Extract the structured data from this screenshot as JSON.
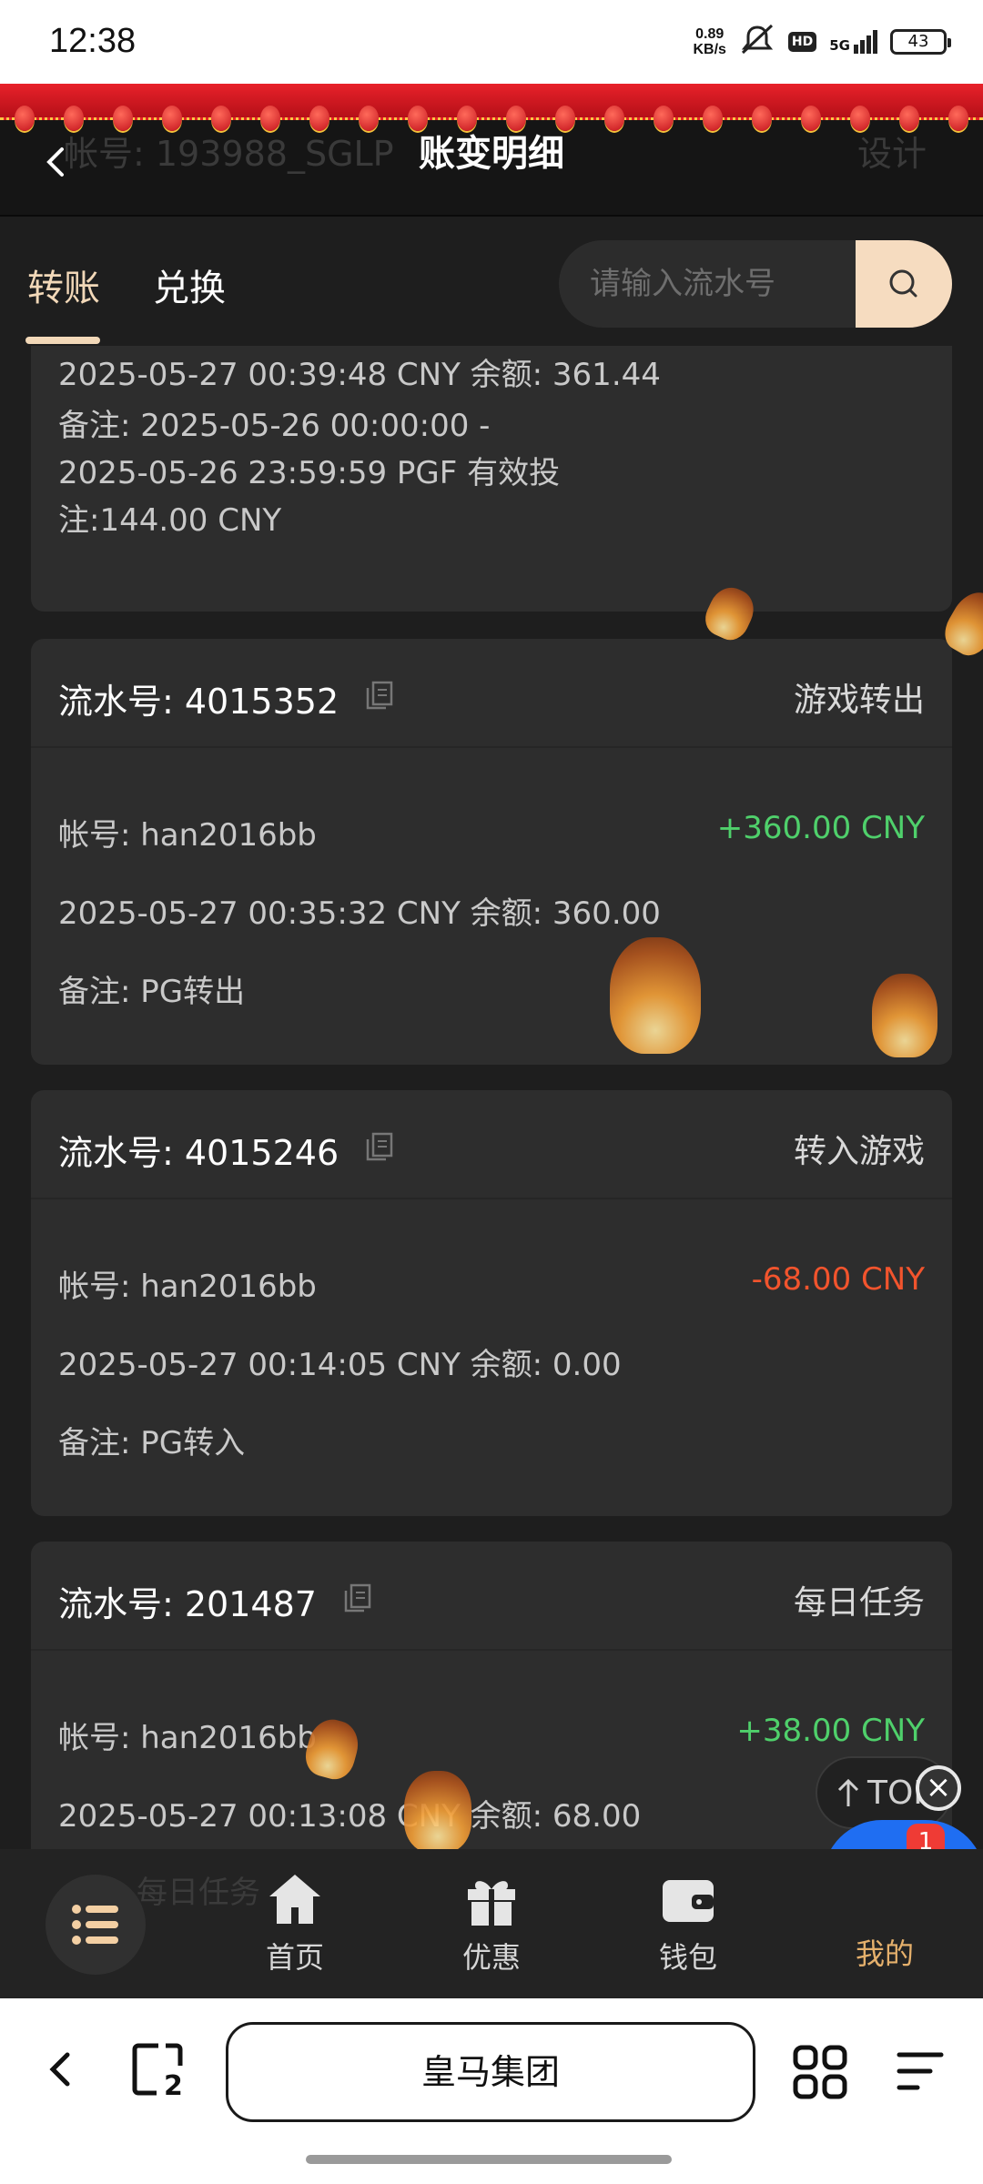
{
  "status_bar": {
    "time": "12:38",
    "net_speed_value": "0.89",
    "net_speed_unit": "KB/s",
    "hd": "HD",
    "network": "5G",
    "battery": "43"
  },
  "header": {
    "title": "账变明细",
    "background_left_text": "帐号: 193988_SGLP",
    "background_right_text": "设计"
  },
  "tabs": [
    {
      "label": "转账",
      "active": true
    },
    {
      "label": "兑换",
      "active": false
    }
  ],
  "search": {
    "placeholder": "请输入流水号",
    "icon": "search-icon"
  },
  "partial_card": {
    "line1": "2025-05-27 00:39:48 CNY 余额: 361.44",
    "remark_line1": "备注: 2025-05-26 00:00:00 -",
    "remark_line2": "2025-05-26 23:59:59 PGF 有效投",
    "remark_line3": "注:144.00 CNY"
  },
  "records": [
    {
      "serial": "流水号: 4015352",
      "type": "游戏转出",
      "account": "帐号: han2016bb",
      "amount": "+360.00 CNY",
      "time_balance": "2025-05-27 00:35:32 CNY 余额: 360.00",
      "remark": "备注: PG转出"
    },
    {
      "serial": "流水号: 4015246",
      "type": "转入游戏",
      "account": "帐号: han2016bb",
      "amount": "-68.00 CNY",
      "time_balance": "2025-05-27 00:14:05 CNY 余额: 0.00",
      "remark": "备注: PG转入"
    },
    {
      "serial": "流水号: 201487",
      "type": "每日任务",
      "account": "帐号: han2016bb",
      "amount": "+38.00 CNY",
      "time_balance": "2025-05-27 00:13:08 CNY 余额: 68.00"
    }
  ],
  "peek_text": "每日任务",
  "top_button": {
    "label": "TOP"
  },
  "float_button": {
    "badge": "1"
  },
  "bottom_nav": [
    {
      "label": "首页",
      "icon": "home-icon"
    },
    {
      "label": "优惠",
      "icon": "gift-icon"
    },
    {
      "label": "钱包",
      "icon": "wallet-icon"
    },
    {
      "label": "我的",
      "icon": "profile-icon",
      "active": true
    }
  ],
  "browser": {
    "url_title": "皇马集团",
    "tab_count": "2"
  },
  "colors": {
    "accent": "#f2d8b8",
    "positive": "#4fd06b",
    "negative": "#f2542d",
    "float_button": "#1f6ef2"
  }
}
